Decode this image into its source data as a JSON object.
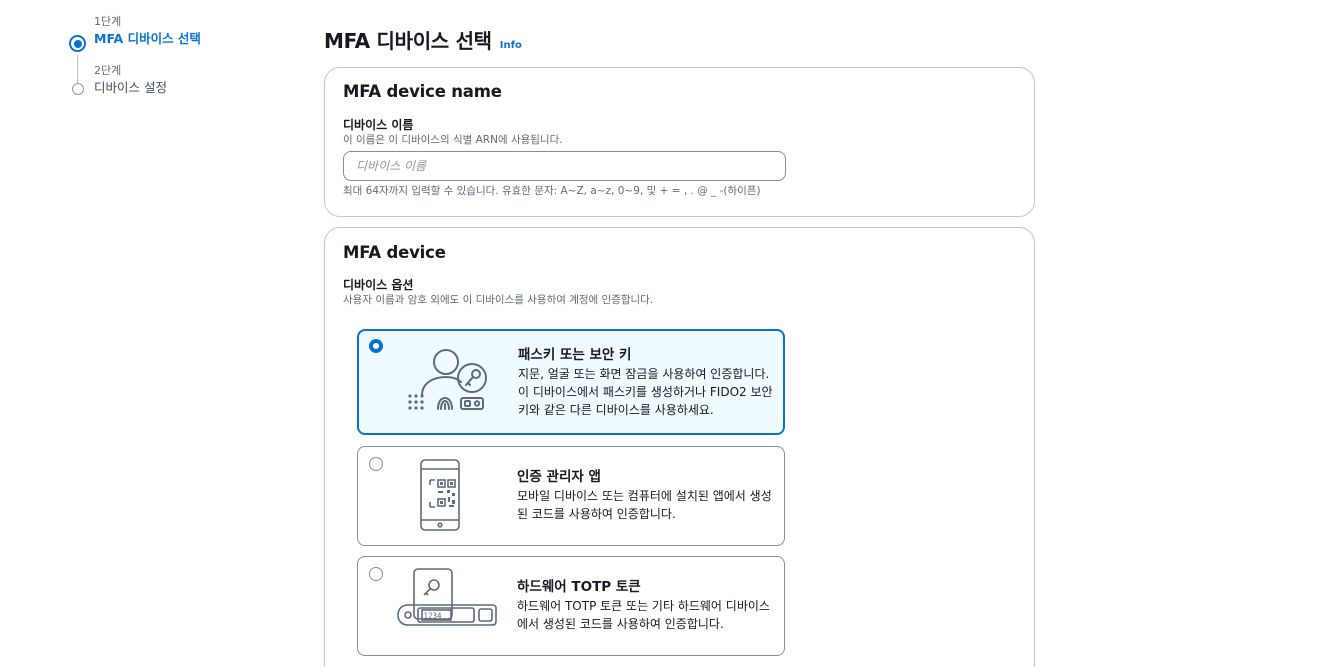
{
  "stepper": {
    "steps": [
      {
        "number": "1단계",
        "title": "MFA 디바이스 선택",
        "state": "active"
      },
      {
        "number": "2단계",
        "title": "디바이스 설정",
        "state": "inactive"
      }
    ]
  },
  "header": {
    "title": "MFA 디바이스 선택",
    "info_label": "Info"
  },
  "device_name_section": {
    "title": "MFA device name",
    "field_label": "디바이스 이름",
    "field_description": "이 이름은 이 디바이스의 식별 ARN에 사용됩니다.",
    "input_value": "",
    "input_placeholder": "디바이스 이름",
    "constraint_text": "최대 64자까지 입력할 수 있습니다. 유효한 문자: A~Z, a~z, 0~9, 및 + = , . @ _ -(하이픈)"
  },
  "device_section": {
    "title": "MFA device",
    "field_label": "디바이스 옵션",
    "field_description": "사용자 이름과 암호 외에도 이 디바이스를 사용하여 계정에 인증합니다.",
    "selected_option": "passkey",
    "options": [
      {
        "id": "passkey",
        "icon": "passkey-security-key-icon",
        "title": "패스키 또는 보안 키",
        "description": "지문, 얼굴 또는 화면 잠금을 사용하여 인증합니다. 이 디바이스에서 패스키를 생성하거나 FIDO2 보안 키와 같은 다른 디바이스를 사용하세요.",
        "selected": true
      },
      {
        "id": "authenticator",
        "icon": "authenticator-app-icon",
        "title": "인증 관리자 앱",
        "description": "모바일 디바이스 또는 컴퓨터에 설치된 앱에서 생성된 코드를 사용하여 인증합니다.",
        "selected": false
      },
      {
        "id": "hardware-totp",
        "icon": "hardware-totp-token-icon",
        "title": "하드웨어 TOTP 토큰",
        "description": "하드웨어 TOTP 토큰 또는 기타 하드웨어 디바이스에서 생성된 코드를 사용하여 인증합니다.",
        "token_display": "1234",
        "selected": false
      }
    ]
  },
  "colors": {
    "accent": "#0972d3",
    "selected_tile_bg": "#f0fbff",
    "border": "#c6c6cd",
    "muted_text": "#5f6b7a"
  }
}
